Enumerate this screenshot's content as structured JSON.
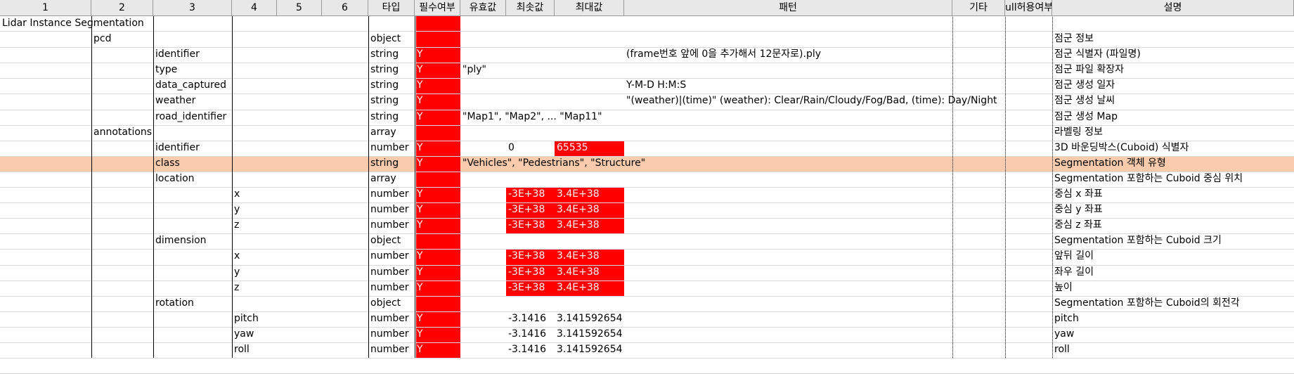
{
  "columns": [
    "1",
    "2",
    "3",
    "4",
    "5",
    "6",
    "타입",
    "필수여부",
    "유효값",
    "최솟값",
    "최대값",
    "패턴",
    "기타",
    "ull허용여부",
    "설명"
  ],
  "title": "Lidar Instance Segmentation",
  "colors": {
    "required_fill": "#ff0000",
    "highlight_row": "#f8cbad",
    "header_bg": "#e8e8e8"
  },
  "rows": [
    {
      "c1": "",
      "c2": "pcd",
      "c3": "",
      "c4": "",
      "type": "object",
      "req": "",
      "valid": "",
      "min": "",
      "max": "",
      "pattern": "",
      "desc": "점군 정보"
    },
    {
      "c1": "",
      "c2": "",
      "c3": "identifier",
      "c4": "",
      "type": "string",
      "req": "Y",
      "valid": "",
      "min": "",
      "max": "",
      "pattern": "(frame번호 앞에 0을 추가해서 12문자로).ply",
      "desc": "점군 식별자 (파일명)"
    },
    {
      "c1": "",
      "c2": "",
      "c3": "type",
      "c4": "",
      "type": "string",
      "req": "Y",
      "valid": "\"ply\"",
      "min": "",
      "max": "",
      "pattern": "",
      "desc": "점군 파일 확장자"
    },
    {
      "c1": "",
      "c2": "",
      "c3": "data_captured",
      "c4": "",
      "type": "string",
      "req": "Y",
      "valid": "",
      "min": "",
      "max": "",
      "pattern": "Y-M-D H:M:S",
      "desc": "점군 생성 일자"
    },
    {
      "c1": "",
      "c2": "",
      "c3": "weather",
      "c4": "",
      "type": "string",
      "req": "Y",
      "valid": "",
      "min": "",
      "max": "",
      "pattern": "\"(weather)|(time)\"   (weather): Clear/Rain/Cloudy/Fog/Bad, (time): Day/Night",
      "desc": "점군 생성 날씨"
    },
    {
      "c1": "",
      "c2": "",
      "c3": "road_identifier",
      "c4": "",
      "type": "string",
      "req": "Y",
      "valid": "\"Map1\", \"Map2\", ... \"Map11\"",
      "min": "",
      "max": "",
      "pattern": "",
      "desc": "점군 생성 Map"
    },
    {
      "c1": "",
      "c2": "annotations",
      "c3": "",
      "c4": "",
      "type": "array",
      "req": "",
      "valid": "",
      "min": "",
      "max": "",
      "pattern": "",
      "desc": "라벨링 정보"
    },
    {
      "c1": "",
      "c2": "",
      "c3": "identifier",
      "c4": "",
      "type": "number",
      "req": "Y",
      "valid": "",
      "min": "0",
      "max": "65535",
      "pattern": "",
      "desc": "3D 바운딩박스(Cuboid) 식별자"
    },
    {
      "c1": "",
      "c2": "",
      "c3": "class",
      "c4": "",
      "type": "string",
      "req": "Y",
      "valid": "\"Vehicles\", \"Pedestrians\", \"Structure\"",
      "min": "",
      "max": "",
      "pattern": "",
      "desc": "Segmentation 객체 유형"
    },
    {
      "c1": "",
      "c2": "",
      "c3": "location",
      "c4": "",
      "type": "array",
      "req": "",
      "valid": "",
      "min": "",
      "max": "",
      "pattern": "",
      "desc": "Segmentation 포함하는 Cuboid 중심 위치"
    },
    {
      "c1": "",
      "c2": "",
      "c3": "",
      "c4": "x",
      "type": "number",
      "req": "Y",
      "valid": "",
      "min": "-3E+38",
      "max": "3.4E+38",
      "pattern": "",
      "desc": "중심 x 좌표"
    },
    {
      "c1": "",
      "c2": "",
      "c3": "",
      "c4": "y",
      "type": "number",
      "req": "Y",
      "valid": "",
      "min": "-3E+38",
      "max": "3.4E+38",
      "pattern": "",
      "desc": "중심 y 좌표"
    },
    {
      "c1": "",
      "c2": "",
      "c3": "",
      "c4": "z",
      "type": "number",
      "req": "Y",
      "valid": "",
      "min": "-3E+38",
      "max": "3.4E+38",
      "pattern": "",
      "desc": "중심 z 좌표"
    },
    {
      "c1": "",
      "c2": "",
      "c3": "dimension",
      "c4": "",
      "type": "object",
      "req": "",
      "valid": "",
      "min": "",
      "max": "",
      "pattern": "",
      "desc": "Segmentation 포함하는 Cuboid 크기"
    },
    {
      "c1": "",
      "c2": "",
      "c3": "",
      "c4": "x",
      "type": "number",
      "req": "Y",
      "valid": "",
      "min": "-3E+38",
      "max": "3.4E+38",
      "pattern": "",
      "desc": "앞뒤 길이"
    },
    {
      "c1": "",
      "c2": "",
      "c3": "",
      "c4": "y",
      "type": "number",
      "req": "Y",
      "valid": "",
      "min": "-3E+38",
      "max": "3.4E+38",
      "pattern": "",
      "desc": "좌우 길이"
    },
    {
      "c1": "",
      "c2": "",
      "c3": "",
      "c4": "z",
      "type": "number",
      "req": "Y",
      "valid": "",
      "min": "-3E+38",
      "max": "3.4E+38",
      "pattern": "",
      "desc": "높이"
    },
    {
      "c1": "",
      "c2": "",
      "c3": "rotation",
      "c4": "",
      "type": "object",
      "req": "",
      "valid": "",
      "min": "",
      "max": "",
      "pattern": "",
      "desc": "Segmentation 포함하는 Cuboid의 회전각"
    },
    {
      "c1": "",
      "c2": "",
      "c3": "",
      "c4": "pitch",
      "type": "number",
      "req": "Y",
      "valid": "",
      "min": "-3.1416",
      "max": "3.141592654",
      "pattern": "",
      "desc": "pitch"
    },
    {
      "c1": "",
      "c2": "",
      "c3": "",
      "c4": "yaw",
      "type": "number",
      "req": "Y",
      "valid": "",
      "min": "-3.1416",
      "max": "3.141592654",
      "pattern": "",
      "desc": "yaw"
    },
    {
      "c1": "",
      "c2": "",
      "c3": "",
      "c4": "roll",
      "type": "number",
      "req": "Y",
      "valid": "",
      "min": "-3.1416",
      "max": "3.141592654",
      "pattern": "",
      "desc": "roll"
    }
  ]
}
